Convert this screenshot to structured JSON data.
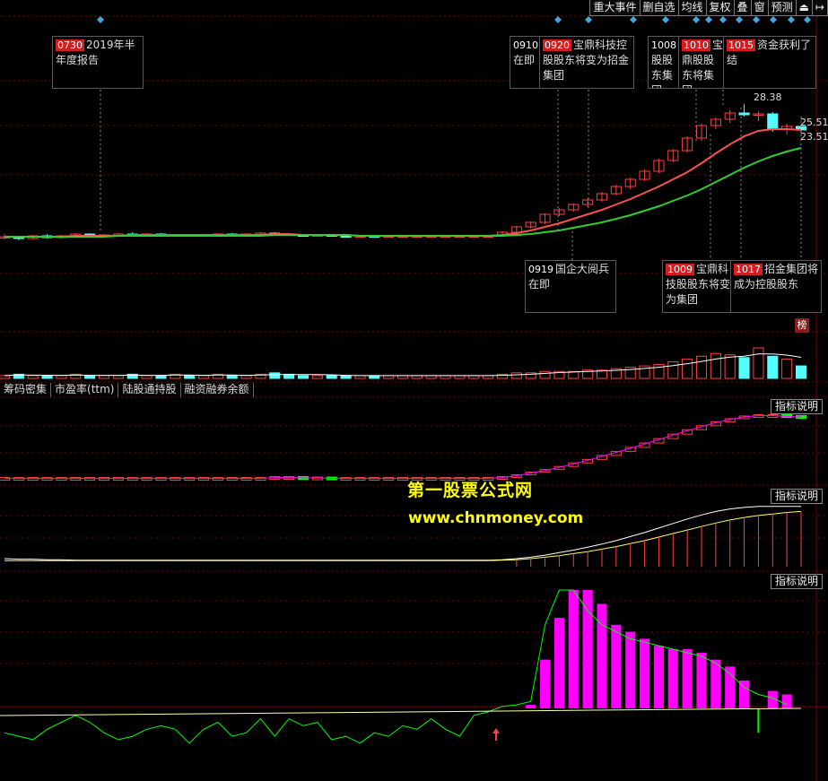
{
  "toolbar": {
    "items": [
      {
        "label": "重大事件"
      },
      {
        "label": "删自选"
      },
      {
        "label": "均线"
      },
      {
        "label": "复权"
      },
      {
        "label": "叠"
      },
      {
        "label": "窗"
      },
      {
        "label": "预测"
      },
      {
        "label": "⏏"
      },
      {
        "label": "↦"
      }
    ]
  },
  "tabs": [
    {
      "label": "筹码密集"
    },
    {
      "label": "市盈率(ttm)"
    },
    {
      "label": "陆股通持股"
    },
    {
      "label": "融资融券余额"
    }
  ],
  "indicator_button_label": "指标说明",
  "side_badge": "榜",
  "watermark": {
    "line1": "第一股票公式网",
    "line2": "www.chnmoney.com"
  },
  "events": {
    "e0730": {
      "date": "0730",
      "text": "2019年半年度报告"
    },
    "e0910": {
      "date": "0910",
      "text": "在即"
    },
    "e0920": {
      "date": "0920",
      "text": "宝鼎科技控股股东将变为招金集团"
    },
    "e1008": {
      "date": "1008",
      "text": "股股东集团"
    },
    "e1010": {
      "date": "1010",
      "text": "宝鼎股股东将集团"
    },
    "e1015": {
      "date": "1015",
      "text": "资金获利了结"
    },
    "e0919": {
      "date": "0919",
      "text": "国企大阅兵在即"
    },
    "e1009": {
      "date": "1009",
      "text": "宝鼎科技股股东将变为集团"
    },
    "e1017": {
      "date": "1017",
      "text": "招金集团将成为控股股东"
    }
  },
  "price_labels": {
    "high": "28.38",
    "ma_upper": "25.51",
    "ma_lower": "23.51"
  },
  "colors": {
    "background": "#000000",
    "up": "#ff4040",
    "down": "#54ffff",
    "ma_short": "#ff5050",
    "ma_long": "#33cc33",
    "white_line": "#ffffff",
    "yellow_line": "#ffff66",
    "magenta": "#ff00ff",
    "green": "#00ff00",
    "grid": "#7a0000",
    "marker": "#3fa6e0"
  },
  "chart_data": {
    "type": "candlestick",
    "price_series": {
      "candles": [
        [
          13.5,
          13.9,
          13.3,
          13.6
        ],
        [
          13.6,
          13.7,
          13.2,
          13.4
        ],
        [
          13.4,
          13.8,
          13.3,
          13.7
        ],
        [
          13.7,
          13.9,
          13.4,
          13.5
        ],
        [
          13.5,
          13.8,
          13.4,
          13.7
        ],
        [
          13.7,
          14.0,
          13.6,
          13.9
        ],
        [
          13.9,
          14.0,
          13.6,
          13.7
        ],
        [
          13.7,
          13.9,
          13.5,
          13.8
        ],
        [
          13.8,
          14.0,
          13.7,
          13.9
        ],
        [
          13.9,
          14.1,
          13.7,
          13.8
        ],
        [
          13.8,
          14.0,
          13.6,
          13.9
        ],
        [
          13.9,
          14.0,
          13.6,
          13.7
        ],
        [
          13.7,
          13.9,
          13.6,
          13.8
        ],
        [
          13.8,
          13.9,
          13.6,
          13.7
        ],
        [
          13.7,
          13.9,
          13.6,
          13.8
        ],
        [
          13.8,
          14.0,
          13.7,
          13.9
        ],
        [
          13.9,
          14.0,
          13.7,
          13.8
        ],
        [
          13.8,
          14.0,
          13.7,
          13.9
        ],
        [
          13.9,
          14.1,
          13.8,
          14.0
        ],
        [
          14.0,
          14.1,
          13.8,
          13.9
        ],
        [
          13.9,
          14.0,
          13.7,
          13.8
        ],
        [
          13.8,
          13.9,
          13.6,
          13.7
        ],
        [
          13.7,
          13.9,
          13.6,
          13.8
        ],
        [
          13.8,
          13.9,
          13.6,
          13.7
        ],
        [
          13.7,
          13.8,
          13.5,
          13.6
        ],
        [
          13.6,
          13.8,
          13.5,
          13.7
        ],
        [
          13.7,
          13.8,
          13.5,
          13.6
        ],
        [
          13.6,
          13.8,
          13.5,
          13.7
        ],
        [
          13.7,
          13.8,
          13.6,
          13.7
        ],
        [
          13.7,
          13.8,
          13.6,
          13.7
        ],
        [
          13.7,
          13.8,
          13.6,
          13.7
        ],
        [
          13.7,
          13.8,
          13.6,
          13.7
        ],
        [
          13.7,
          13.8,
          13.6,
          13.7
        ],
        [
          13.7,
          13.8,
          13.6,
          13.7
        ],
        [
          13.7,
          13.8,
          13.6,
          13.7
        ],
        [
          13.7,
          14.2,
          13.6,
          14.1
        ],
        [
          14.1,
          14.8,
          14.0,
          14.7
        ],
        [
          14.7,
          15.3,
          14.5,
          15.2
        ],
        [
          15.2,
          16.2,
          15.0,
          16.1
        ],
        [
          16.1,
          16.8,
          15.9,
          16.6
        ],
        [
          16.6,
          17.3,
          16.4,
          17.2
        ],
        [
          17.2,
          17.9,
          16.9,
          17.7
        ],
        [
          17.7,
          18.6,
          17.5,
          18.4
        ],
        [
          18.4,
          19.4,
          18.2,
          19.2
        ],
        [
          19.2,
          20.2,
          18.9,
          20.0
        ],
        [
          20.0,
          21.1,
          19.8,
          20.9
        ],
        [
          20.9,
          22.3,
          20.7,
          22.1
        ],
        [
          22.1,
          23.4,
          21.9,
          23.2
        ],
        [
          23.2,
          24.8,
          23.0,
          24.6
        ],
        [
          24.6,
          26.2,
          24.3,
          26.0
        ],
        [
          26.0,
          26.9,
          25.6,
          26.7
        ],
        [
          26.7,
          27.7,
          26.3,
          27.4
        ],
        [
          27.4,
          28.38,
          27.0,
          27.2
        ],
        [
          27.2,
          27.6,
          26.5,
          27.3
        ],
        [
          27.3,
          27.5,
          25.3,
          25.6
        ],
        [
          25.6,
          26.2,
          25.0,
          25.9
        ],
        [
          25.9,
          26.1,
          25.2,
          25.51
        ]
      ],
      "ma_short": [
        13.6,
        13.6,
        13.6,
        13.6,
        13.6,
        13.7,
        13.7,
        13.7,
        13.7,
        13.8,
        13.8,
        13.8,
        13.8,
        13.8,
        13.8,
        13.8,
        13.8,
        13.8,
        13.8,
        13.9,
        13.9,
        13.8,
        13.8,
        13.8,
        13.8,
        13.7,
        13.7,
        13.7,
        13.7,
        13.7,
        13.7,
        13.7,
        13.7,
        13.7,
        13.7,
        13.8,
        14.0,
        14.3,
        14.7,
        15.1,
        15.6,
        16.1,
        16.6,
        17.2,
        17.8,
        18.5,
        19.2,
        20.0,
        20.8,
        21.8,
        22.9,
        23.9,
        24.8,
        25.4,
        25.6,
        25.6,
        25.51
      ],
      "ma_long": [
        13.6,
        13.6,
        13.6,
        13.6,
        13.6,
        13.6,
        13.6,
        13.6,
        13.7,
        13.7,
        13.7,
        13.7,
        13.7,
        13.7,
        13.7,
        13.7,
        13.7,
        13.7,
        13.7,
        13.8,
        13.8,
        13.8,
        13.8,
        13.8,
        13.8,
        13.7,
        13.7,
        13.7,
        13.7,
        13.7,
        13.7,
        13.7,
        13.7,
        13.7,
        13.7,
        13.7,
        13.8,
        13.9,
        14.1,
        14.3,
        14.6,
        14.9,
        15.2,
        15.6,
        16.0,
        16.5,
        17.0,
        17.6,
        18.2,
        18.9,
        19.7,
        20.5,
        21.3,
        22.0,
        22.6,
        23.1,
        23.51
      ]
    },
    "volume": [
      2,
      3,
      2,
      2,
      2,
      3,
      2,
      2,
      2,
      3,
      2,
      2,
      3,
      2,
      2,
      3,
      2,
      2,
      3,
      4,
      3,
      2,
      2,
      2,
      2,
      2,
      2,
      2,
      2,
      2,
      2,
      2,
      2,
      2,
      2,
      3,
      4,
      4,
      5,
      5,
      5,
      6,
      6,
      7,
      8,
      9,
      10,
      12,
      14,
      16,
      18,
      17,
      15,
      22,
      16,
      14,
      9
    ],
    "panel_upper": [
      1.0,
      1.0,
      1.0,
      1.0,
      1.0,
      1.0,
      1.0,
      1.0,
      1.0,
      1.0,
      1.0,
      1.0,
      1.0,
      1.0,
      1.0,
      1.0,
      1.0,
      1.0,
      1.0,
      1.2,
      1.2,
      1.1,
      1.1,
      1.0,
      1.0,
      1.0,
      1.0,
      1.0,
      1.0,
      1.0,
      1.0,
      1.0,
      1.0,
      1.0,
      1.0,
      1.2,
      1.6,
      2.2,
      2.8,
      3.5,
      4.3,
      5.1,
      6.0,
      6.9,
      7.8,
      8.8,
      9.8,
      10.8,
      11.8,
      12.7,
      13.6,
      14.3,
      14.9,
      15.2,
      15.2,
      15.0,
      14.9
    ],
    "panel_middle": {
      "white": [
        1.6,
        1.5,
        1.5,
        1.4,
        1.4,
        1.3,
        1.3,
        1.3,
        1.3,
        1.3,
        1.3,
        1.3,
        1.3,
        1.3,
        1.3,
        1.3,
        1.3,
        1.3,
        1.3,
        1.3,
        1.3,
        1.3,
        1.3,
        1.3,
        1.3,
        1.3,
        1.3,
        1.3,
        1.3,
        1.3,
        1.3,
        1.3,
        1.3,
        1.3,
        1.3,
        1.4,
        1.6,
        1.9,
        2.3,
        2.8,
        3.3,
        3.9,
        4.5,
        5.2,
        6.0,
        6.8,
        7.7,
        8.6,
        9.5,
        10.3,
        11.0,
        11.5,
        11.8,
        12.0,
        12.0,
        12.0,
        12.0
      ],
      "yellow": [
        1.2,
        1.2,
        1.2,
        1.2,
        1.2,
        1.2,
        1.2,
        1.2,
        1.2,
        1.2,
        1.2,
        1.2,
        1.2,
        1.2,
        1.2,
        1.2,
        1.2,
        1.2,
        1.2,
        1.2,
        1.2,
        1.2,
        1.2,
        1.2,
        1.2,
        1.2,
        1.2,
        1.2,
        1.2,
        1.2,
        1.2,
        1.2,
        1.2,
        1.2,
        1.2,
        1.3,
        1.4,
        1.6,
        1.9,
        2.2,
        2.6,
        3.0,
        3.5,
        4.0,
        4.6,
        5.2,
        5.9,
        6.6,
        7.3,
        8.0,
        8.7,
        9.3,
        9.8,
        10.2,
        10.5,
        10.8,
        11.0
      ]
    },
    "panel_lower": {
      "bars": [
        0,
        0,
        0,
        0,
        0,
        0,
        0,
        0,
        0,
        0,
        0,
        0,
        0,
        0,
        0,
        0,
        0,
        0,
        0,
        0,
        0,
        0,
        0,
        0,
        0,
        0,
        0,
        0,
        0,
        0,
        0,
        0,
        0,
        0,
        0,
        0,
        0,
        0.5,
        7,
        13,
        17,
        17,
        15,
        12,
        11,
        10,
        9,
        8.5,
        8.5,
        8,
        7,
        6,
        4,
        -3.5,
        2.5,
        2
      ],
      "line": [
        -3.5,
        -4,
        -4.5,
        -3,
        -2,
        -1,
        -2,
        -3.5,
        -4.5,
        -4,
        -3,
        -2.5,
        -3,
        -5,
        -3,
        -2,
        -4,
        -3.5,
        -1.5,
        -4,
        -1.5,
        -2.5,
        -2,
        -4.5,
        -4,
        -5,
        -3.5,
        -4,
        -2.5,
        -3,
        -1.5,
        -3,
        -4,
        -1,
        -0.5,
        0.3,
        0.5,
        1,
        12,
        17,
        17,
        14,
        12,
        11,
        10,
        9.5,
        9,
        8.5,
        8,
        7.5,
        6.5,
        5,
        3,
        2,
        1.5,
        0.5
      ]
    }
  }
}
